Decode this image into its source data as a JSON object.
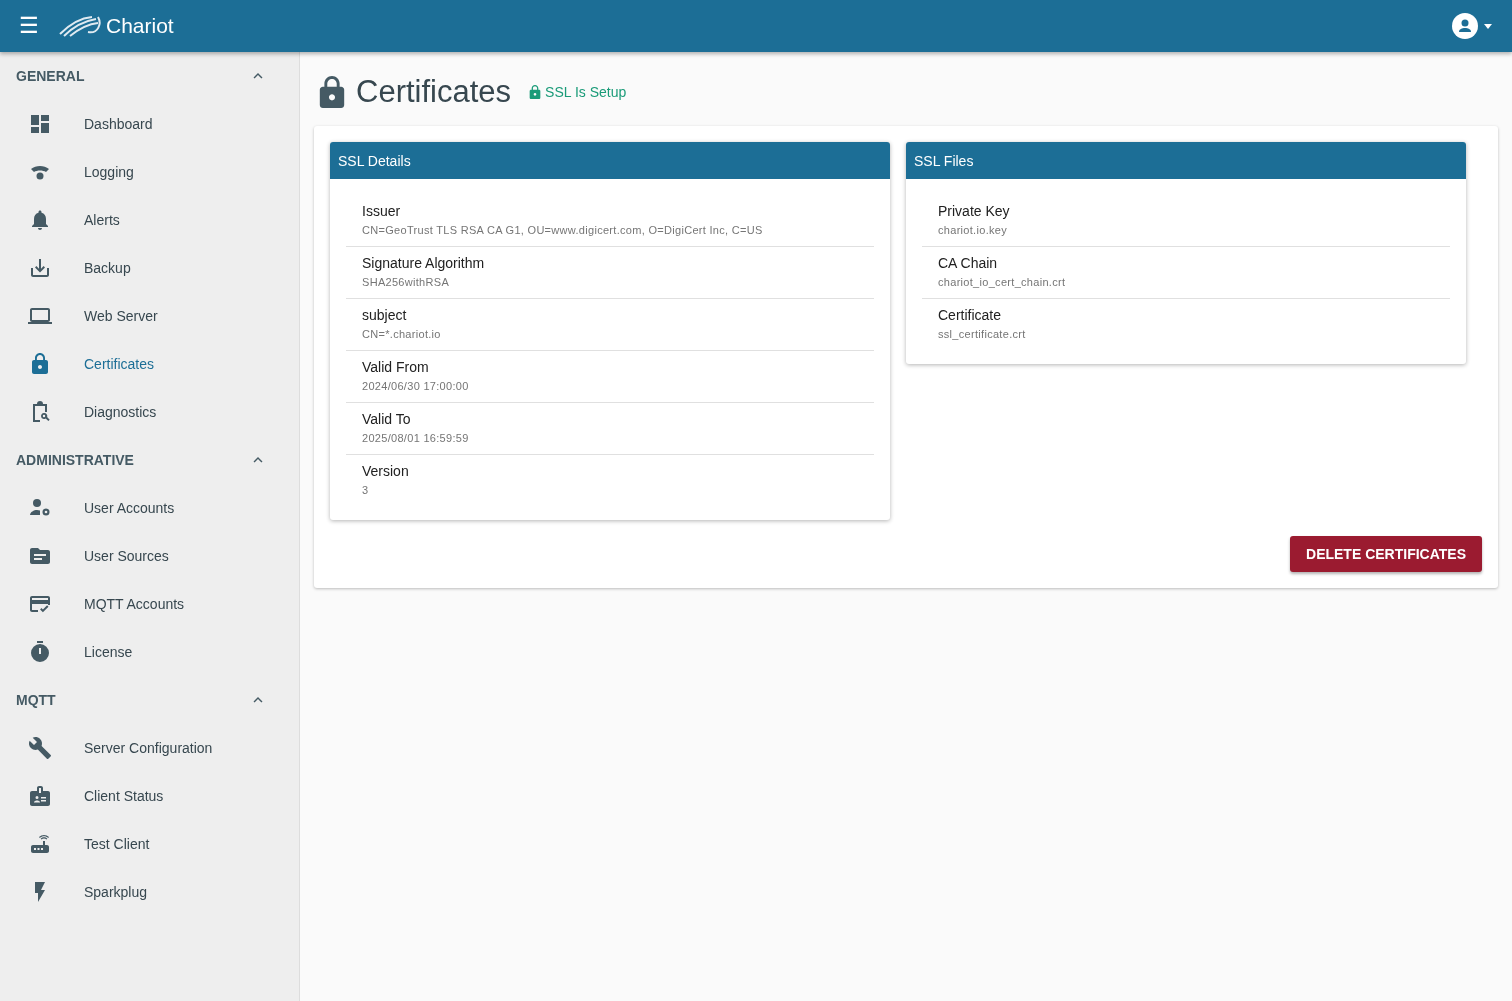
{
  "app_bar": {
    "menu_icon": "☰",
    "brand": "Chariot"
  },
  "sidebar": {
    "groups": [
      {
        "title": "GENERAL",
        "expanded": true,
        "items": [
          {
            "label": "Dashboard",
            "selected": false
          },
          {
            "label": "Logging",
            "selected": false
          },
          {
            "label": "Alerts",
            "selected": false
          },
          {
            "label": "Backup",
            "selected": false
          },
          {
            "label": "Web Server",
            "selected": false
          },
          {
            "label": "Certificates",
            "selected": true
          },
          {
            "label": "Diagnostics",
            "selected": false
          }
        ]
      },
      {
        "title": "ADMINISTRATIVE",
        "expanded": true,
        "items": [
          {
            "label": "User Accounts",
            "selected": false
          },
          {
            "label": "User Sources",
            "selected": false
          },
          {
            "label": "MQTT Accounts",
            "selected": false
          },
          {
            "label": "License",
            "selected": false
          }
        ]
      },
      {
        "title": "MQTT",
        "expanded": true,
        "items": [
          {
            "label": "Server Configuration",
            "selected": false
          },
          {
            "label": "Client Status",
            "selected": false
          },
          {
            "label": "Test Client",
            "selected": false
          },
          {
            "label": "Sparkplug",
            "selected": false
          }
        ]
      }
    ]
  },
  "page": {
    "title": "Certificates",
    "status": "SSL Is Setup"
  },
  "panels": [
    {
      "title": "SSL Details",
      "rows": [
        {
          "label": "Issuer",
          "value": "CN=GeoTrust TLS RSA CA G1, OU=www.digicert.com, O=DigiCert Inc, C=US"
        },
        {
          "label": "Signature Algorithm",
          "value": "SHA256withRSA"
        },
        {
          "label": "subject",
          "value": "CN=*.chariot.io"
        },
        {
          "label": "Valid From",
          "value": "2024/06/30 17:00:00"
        },
        {
          "label": "Valid To",
          "value": "2025/08/01 16:59:59"
        },
        {
          "label": "Version",
          "value": "3"
        }
      ]
    },
    {
      "title": "SSL Files",
      "rows": [
        {
          "label": "Private Key",
          "value": "chariot.io.key"
        },
        {
          "label": "CA Chain",
          "value": "chariot_io_cert_chain.crt"
        },
        {
          "label": "Certificate",
          "value": "ssl_certificate.crt"
        }
      ]
    }
  ],
  "actions": [
    {
      "label": "DELETE CERTIFICATES"
    }
  ]
}
